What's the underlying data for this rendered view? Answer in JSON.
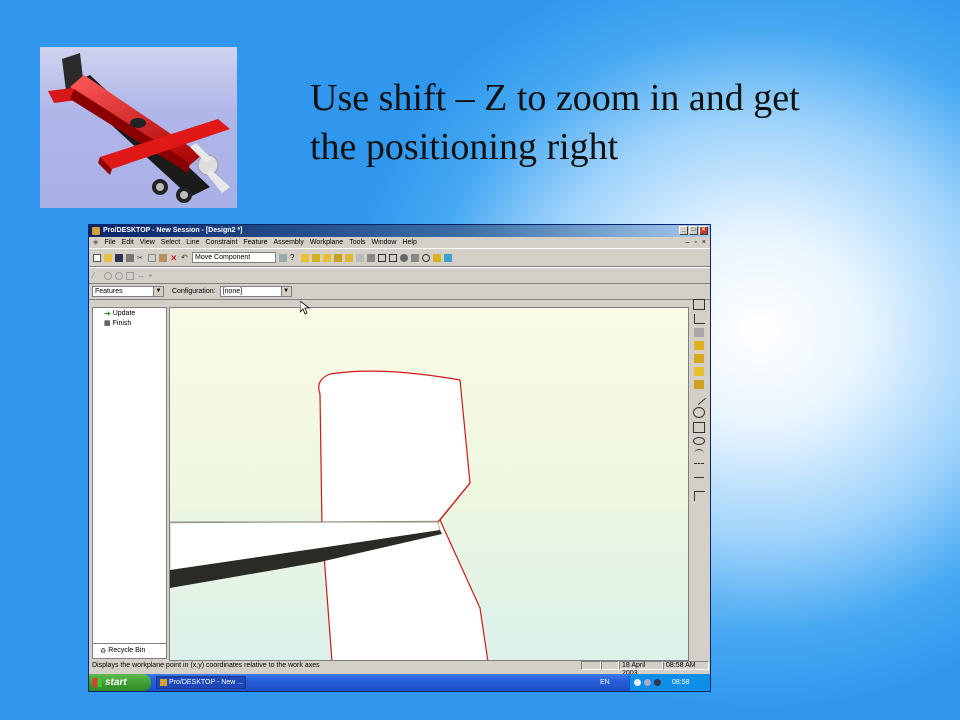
{
  "slide": {
    "caption_line1": "Use shift – Z to zoom in and get",
    "caption_line2": "the positioning right"
  },
  "window": {
    "title": "Pro/DESKTOP - New Session - [Design2 *]",
    "menu": [
      "File",
      "Edit",
      "View",
      "Select",
      "Line",
      "Constraint",
      "Feature",
      "Assembly",
      "Workplane",
      "Tools",
      "Window",
      "Help"
    ],
    "toolbar_combo": "Move Component",
    "pane_combo": "Features",
    "configuration_label": "Configuration:",
    "configuration_value": "[none]",
    "tree_items": [
      "Update",
      "Finish"
    ],
    "recycle_bin": "Recycle Bin",
    "status_text": "Displays the workplane point in (x,y) coordinates relative to the work axes",
    "status_date": "18 April 2003",
    "status_time": "08:58 AM"
  },
  "taskbar": {
    "start_label": "start",
    "task_label": "Pro/DESKTOP - New ...",
    "lang": "EN",
    "clock": "08:58"
  },
  "colors": {
    "slide_bg": "#2f98ee",
    "titlebar": "#0a246a",
    "outline": "#d01818",
    "taskbar": "#245edb",
    "start": "#3c9a2f"
  }
}
